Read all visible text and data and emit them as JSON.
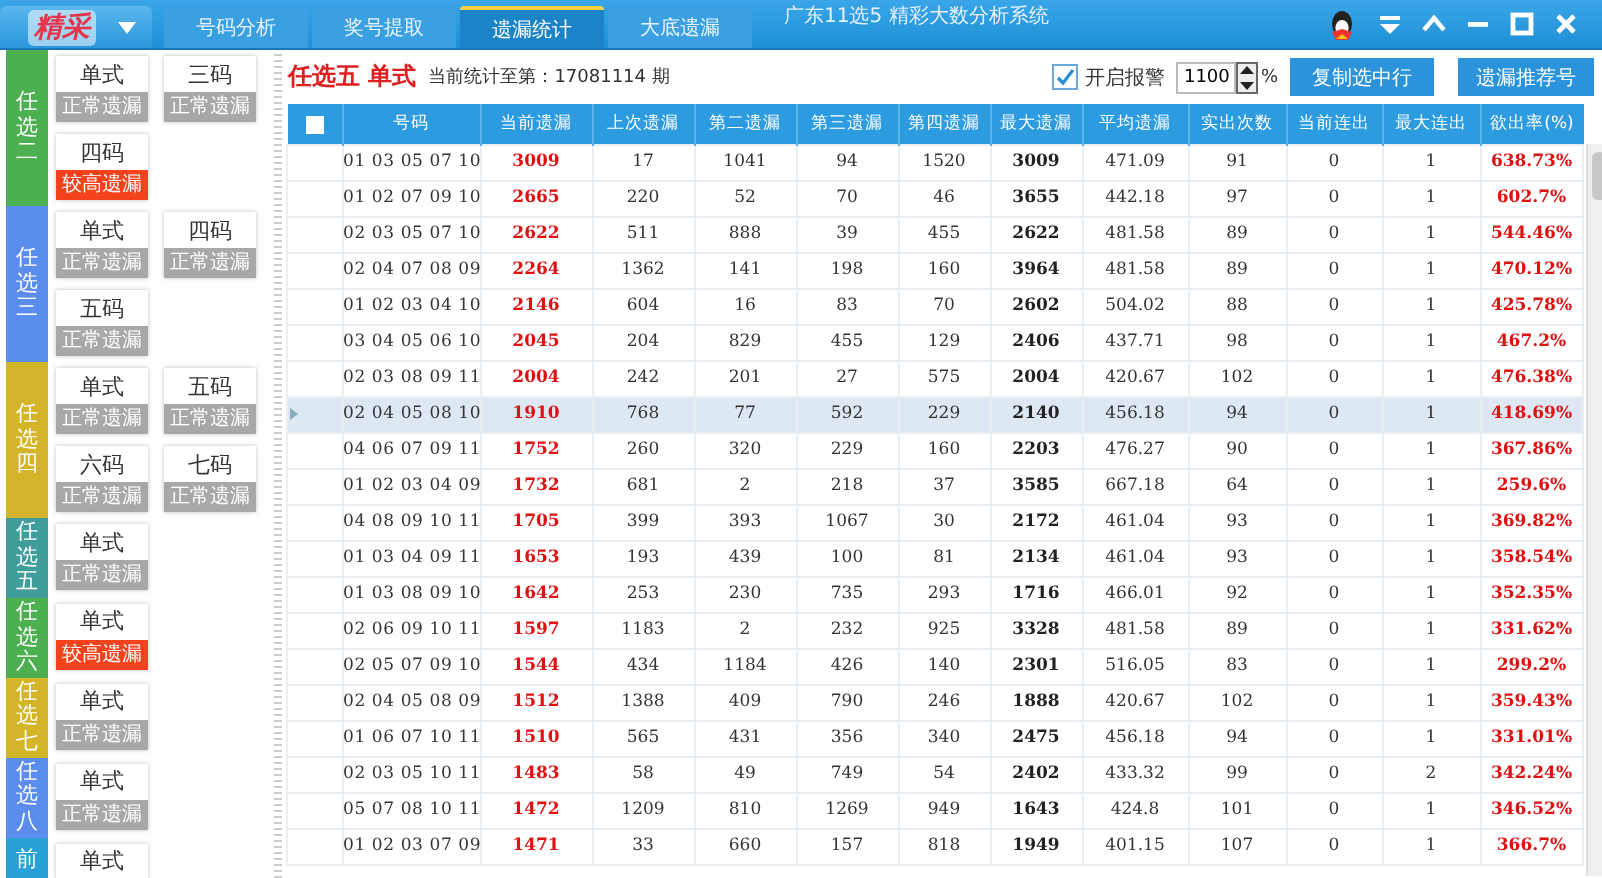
{
  "app": {
    "logo": "精采",
    "title": "广东11选5 精彩大数分析系统"
  },
  "tabs": [
    {
      "label": "号码分析",
      "selected": false
    },
    {
      "label": "奖号提取",
      "selected": false
    },
    {
      "label": "遗漏统计",
      "selected": true
    },
    {
      "label": "大底遗漏",
      "selected": false
    }
  ],
  "sidebar": {
    "groups": [
      {
        "label": "任选二",
        "color": "#4caf50",
        "cards": [
          {
            "label": "单式",
            "status": "正常遗漏",
            "high": false
          },
          {
            "label": "三码",
            "status": "正常遗漏",
            "high": false
          },
          {
            "label": "四码",
            "status": "较高遗漏",
            "high": true
          }
        ]
      },
      {
        "label": "任选三",
        "color": "#5b8def",
        "cards": [
          {
            "label": "单式",
            "status": "正常遗漏",
            "high": false
          },
          {
            "label": "四码",
            "status": "正常遗漏",
            "high": false
          },
          {
            "label": "五码",
            "status": "正常遗漏",
            "high": false
          }
        ]
      },
      {
        "label": "任选四",
        "color": "#d4b428",
        "cards": [
          {
            "label": "单式",
            "status": "正常遗漏",
            "high": false
          },
          {
            "label": "五码",
            "status": "正常遗漏",
            "high": false
          },
          {
            "label": "六码",
            "status": "正常遗漏",
            "high": false
          },
          {
            "label": "七码",
            "status": "正常遗漏",
            "high": false
          }
        ]
      },
      {
        "label": "任选五",
        "color": "#3f9e9a",
        "cards": [
          {
            "label": "单式",
            "status": "正常遗漏",
            "high": false
          }
        ]
      },
      {
        "label": "任选六",
        "color": "#4caf50",
        "cards": [
          {
            "label": "单式",
            "status": "较高遗漏",
            "high": true
          }
        ]
      },
      {
        "label": "任选七",
        "color": "#d4b428",
        "cards": [
          {
            "label": "单式",
            "status": "正常遗漏",
            "high": false
          }
        ]
      },
      {
        "label": "任选八",
        "color": "#5b8def",
        "cards": [
          {
            "label": "单式",
            "status": "正常遗漏",
            "high": false
          }
        ]
      },
      {
        "label": "前",
        "color": "#2aa0d8",
        "cards": [
          {
            "label": "单式"
          }
        ]
      }
    ]
  },
  "toolbar": {
    "heading": "任选五 单式",
    "period": "当前统计至第：17081114 期",
    "alarm": {
      "label": "开启报警",
      "checked": true
    },
    "threshold": "1100",
    "unit": "%",
    "buttons": [
      "复制选中行",
      "遗漏推荐号"
    ]
  },
  "table": {
    "select_all": {
      "checked": false
    },
    "columns": [
      {
        "label": "号码",
        "kind": "code"
      },
      {
        "label": "当前遗漏",
        "kind": "hot"
      },
      {
        "label": "上次遗漏",
        "kind": "plain"
      },
      {
        "label": "第二遗漏",
        "kind": "plain"
      },
      {
        "label": "第三遗漏",
        "kind": "plain"
      },
      {
        "label": "第四遗漏",
        "kind": "plain"
      },
      {
        "label": "最大遗漏",
        "kind": "bold"
      },
      {
        "label": "平均遗漏",
        "kind": "plain"
      },
      {
        "label": "实出次数",
        "kind": "plain"
      },
      {
        "label": "当前连出",
        "kind": "plain"
      },
      {
        "label": "最大连出",
        "kind": "plain"
      },
      {
        "label": "欲出率(%)",
        "kind": "hot"
      }
    ],
    "rows": [
      {
        "selected": false,
        "cells": [
          "01 03 05 07 10",
          "3009",
          "17",
          "1041",
          "94",
          "1520",
          "3009",
          "471.09",
          "91",
          "0",
          "1",
          "638.73%"
        ]
      },
      {
        "selected": false,
        "cells": [
          "01 02 07 09 10",
          "2665",
          "220",
          "52",
          "70",
          "46",
          "3655",
          "442.18",
          "97",
          "0",
          "1",
          "602.7%"
        ]
      },
      {
        "selected": false,
        "cells": [
          "02 03 05 07 10",
          "2622",
          "511",
          "888",
          "39",
          "455",
          "2622",
          "481.58",
          "89",
          "0",
          "1",
          "544.46%"
        ]
      },
      {
        "selected": false,
        "cells": [
          "02 04 07 08 09",
          "2264",
          "1362",
          "141",
          "198",
          "160",
          "3964",
          "481.58",
          "89",
          "0",
          "1",
          "470.12%"
        ]
      },
      {
        "selected": false,
        "cells": [
          "01 02 03 04 10",
          "2146",
          "604",
          "16",
          "83",
          "70",
          "2602",
          "504.02",
          "88",
          "0",
          "1",
          "425.78%"
        ]
      },
      {
        "selected": false,
        "cells": [
          "03 04 05 06 10",
          "2045",
          "204",
          "829",
          "455",
          "129",
          "2406",
          "437.71",
          "98",
          "0",
          "1",
          "467.2%"
        ]
      },
      {
        "selected": false,
        "cells": [
          "02 03 08 09 11",
          "2004",
          "242",
          "201",
          "27",
          "575",
          "2004",
          "420.67",
          "102",
          "0",
          "1",
          "476.38%"
        ]
      },
      {
        "selected": true,
        "cells": [
          "02 04 05 08 10",
          "1910",
          "768",
          "77",
          "592",
          "229",
          "2140",
          "456.18",
          "94",
          "0",
          "1",
          "418.69%"
        ]
      },
      {
        "selected": false,
        "cells": [
          "04 06 07 09 11",
          "1752",
          "260",
          "320",
          "229",
          "160",
          "2203",
          "476.27",
          "90",
          "0",
          "1",
          "367.86%"
        ]
      },
      {
        "selected": false,
        "cells": [
          "01 02 03 04 09",
          "1732",
          "681",
          "2",
          "218",
          "37",
          "3585",
          "667.18",
          "64",
          "0",
          "1",
          "259.6%"
        ]
      },
      {
        "selected": false,
        "cells": [
          "04 08 09 10 11",
          "1705",
          "399",
          "393",
          "1067",
          "30",
          "2172",
          "461.04",
          "93",
          "0",
          "1",
          "369.82%"
        ]
      },
      {
        "selected": false,
        "cells": [
          "01 03 04 09 11",
          "1653",
          "193",
          "439",
          "100",
          "81",
          "2134",
          "461.04",
          "93",
          "0",
          "1",
          "358.54%"
        ]
      },
      {
        "selected": false,
        "cells": [
          "01 03 08 09 10",
          "1642",
          "253",
          "230",
          "735",
          "293",
          "1716",
          "466.01",
          "92",
          "0",
          "1",
          "352.35%"
        ]
      },
      {
        "selected": false,
        "cells": [
          "02 06 09 10 11",
          "1597",
          "1183",
          "2",
          "232",
          "925",
          "3328",
          "481.58",
          "89",
          "0",
          "1",
          "331.62%"
        ]
      },
      {
        "selected": false,
        "cells": [
          "02 05 07 09 10",
          "1544",
          "434",
          "1184",
          "426",
          "140",
          "2301",
          "516.05",
          "83",
          "0",
          "1",
          "299.2%"
        ]
      },
      {
        "selected": false,
        "cells": [
          "02 04 05 08 09",
          "1512",
          "1388",
          "409",
          "790",
          "246",
          "1888",
          "420.67",
          "102",
          "0",
          "1",
          "359.43%"
        ]
      },
      {
        "selected": false,
        "cells": [
          "01 06 07 10 11",
          "1510",
          "565",
          "431",
          "356",
          "340",
          "2475",
          "456.18",
          "94",
          "0",
          "1",
          "331.01%"
        ]
      },
      {
        "selected": false,
        "cells": [
          "02 03 05 10 11",
          "1483",
          "58",
          "49",
          "749",
          "54",
          "2402",
          "433.32",
          "99",
          "0",
          "2",
          "342.24%"
        ]
      },
      {
        "selected": false,
        "cells": [
          "05 07 08 10 11",
          "1472",
          "1209",
          "810",
          "1269",
          "949",
          "1643",
          "424.8",
          "101",
          "0",
          "1",
          "346.52%"
        ]
      },
      {
        "selected": false,
        "cells": [
          "01 02 03 07 09",
          "1471",
          "33",
          "660",
          "157",
          "818",
          "1949",
          "401.15",
          "107",
          "0",
          "1",
          "366.7%"
        ]
      }
    ]
  }
}
